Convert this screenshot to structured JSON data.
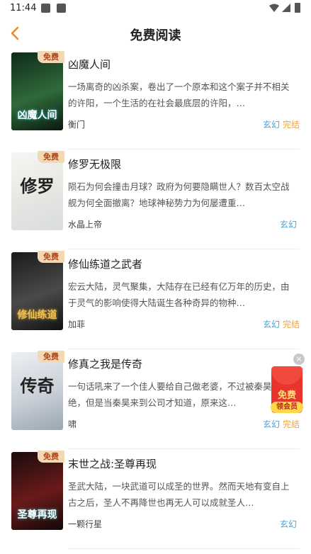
{
  "status_bar": {
    "time": "11:44"
  },
  "header": {
    "title": "免费阅读"
  },
  "badge_label": "免费",
  "books": [
    {
      "title": "凶魔人间",
      "description": "一场离奇的凶杀案，卷出了一个原本和这个案子并不相关的许阳，一个生活的在社会最底层的许阳，…",
      "author": "衡门",
      "genre": "玄幻",
      "status": "完结",
      "cover_text": "凶魔人间",
      "cover_colors": [
        "#0f2a1a",
        "#2f6a3a",
        "#0a1a10"
      ]
    },
    {
      "title": "修罗无极限",
      "description": "陨石为何会撞击月球？政府为何要隐瞒世人？数百太空战舰为何全面撤离？地球神秘势力为何屡遭重…",
      "author": "水晶上帝",
      "genre": "玄幻",
      "status": "",
      "cover_text": "修罗",
      "cover_colors": [
        "#f6f6f4",
        "#e6e6e2",
        "#d9dcdf"
      ]
    },
    {
      "title": "修仙练道之武者",
      "description": "宏云大陆，灵气聚集，大陆存在已经有亿万年的历史，由于灵气的影响使得大陆诞生各种奇异的物种…",
      "author": "加菲",
      "genre": "玄幻",
      "status": "完结",
      "cover_text": "修仙练道",
      "cover_colors": [
        "#1a1a1a",
        "#4a4a4a",
        "#111111"
      ]
    },
    {
      "title": "修真之我是传奇",
      "description": "一句话吼来了一个佳人要给自己做老婆，不过被秦昊拒绝，但是当秦昊来到公司才知道，原来这…",
      "author": "啸",
      "genre": "玄幻",
      "status": "完结",
      "cover_text": "传奇",
      "cover_colors": [
        "#eef0f3",
        "#c9d0d8",
        "#9aa6b2"
      ]
    },
    {
      "title": "末世之战:圣尊再现",
      "description": "圣武大陆，一块武道可以成圣的世界。然而天地有变自上古之后，圣人不再降世也再无人可以成就圣人…",
      "author": "一颗行星",
      "genre": "玄幻",
      "status": "",
      "cover_text": "圣尊再现",
      "cover_colors": [
        "#1a0c0c",
        "#6a1a1a",
        "#120808"
      ]
    }
  ],
  "float_ad": {
    "label": "免费",
    "button": "领会员",
    "close": "×"
  }
}
